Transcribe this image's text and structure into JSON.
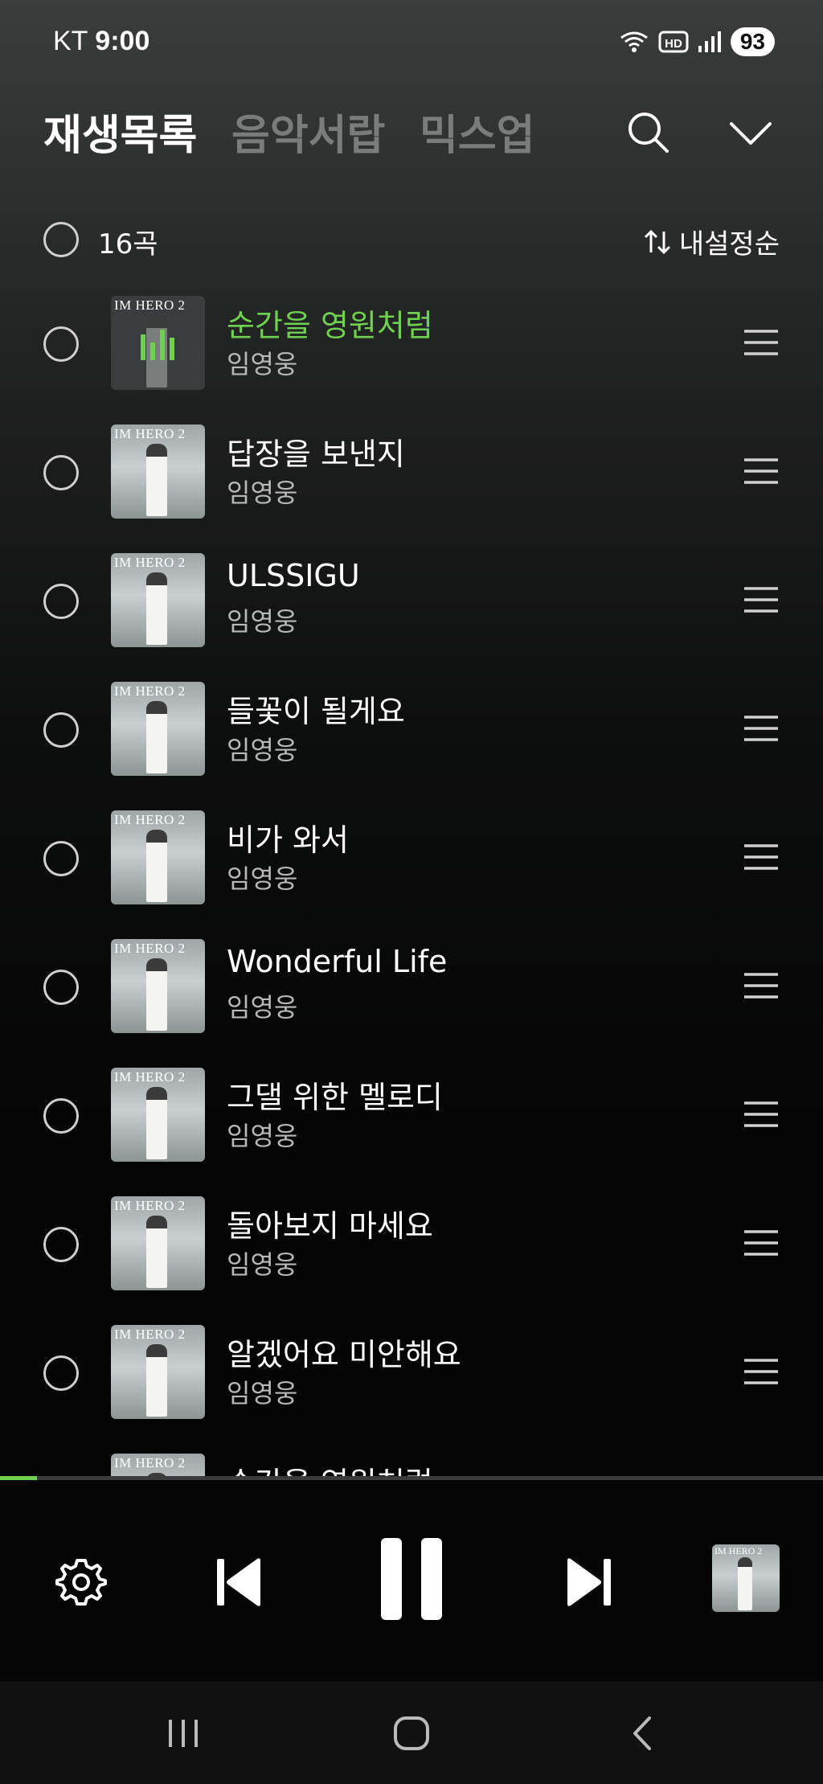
{
  "status_bar": {
    "carrier": "KT",
    "time": "9:00",
    "battery": "93",
    "icons": [
      "wifi-icon",
      "hd-icon",
      "signal-icon",
      "battery-icon"
    ]
  },
  "header": {
    "tabs": [
      {
        "label": "재생목록",
        "active": true
      },
      {
        "label": "음악서랍",
        "active": false
      },
      {
        "label": "믹스업",
        "active": false
      }
    ],
    "icons": [
      "search-icon",
      "chevron-down-icon"
    ]
  },
  "list_header": {
    "count": "16곡",
    "sort_label": "내설정순"
  },
  "tracks": [
    {
      "title": "순간을 영원처럼",
      "artist": "임영웅",
      "playing": true
    },
    {
      "title": "답장을 보낸지",
      "artist": "임영웅"
    },
    {
      "title": "ULSSIGU",
      "artist": "임영웅"
    },
    {
      "title": "들꽃이 될게요",
      "artist": "임영웅"
    },
    {
      "title": "비가 와서",
      "artist": "임영웅"
    },
    {
      "title": "Wonderful Life",
      "artist": "임영웅"
    },
    {
      "title": "그댈 위한 멜로디",
      "artist": "임영웅"
    },
    {
      "title": "돌아보지 마세요",
      "artist": "임영웅"
    },
    {
      "title": "알겠어요 미안해요",
      "artist": "임영웅"
    },
    {
      "title": "순간을 영원처럼",
      "artist": ""
    }
  ],
  "album_cover_text": "IM HERO 2",
  "player": {
    "progress": 0.045,
    "icons": [
      "settings-icon",
      "previous-icon",
      "pause-icon",
      "next-icon"
    ]
  },
  "colors": {
    "accent": "#6fd14f",
    "background": "#050505"
  }
}
